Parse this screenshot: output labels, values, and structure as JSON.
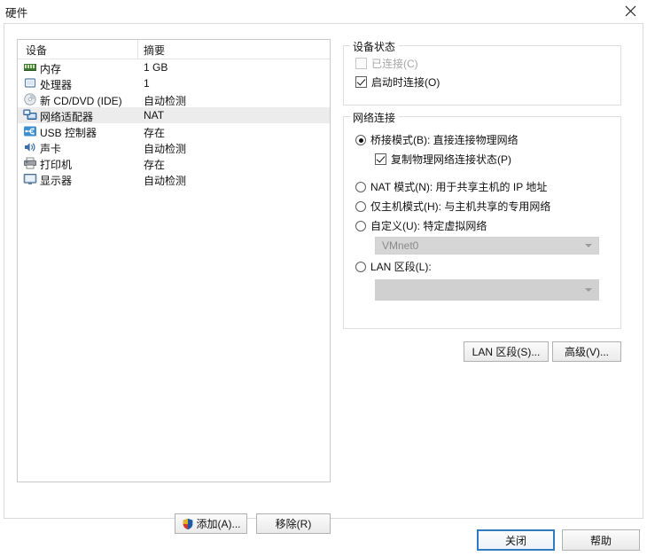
{
  "window": {
    "title": "硬件",
    "close_icon": "close-icon"
  },
  "device_list": {
    "columns": [
      "设备",
      "摘要"
    ],
    "rows": [
      {
        "icon": "memory-icon",
        "name": "内存",
        "summary": "1 GB",
        "selected": false
      },
      {
        "icon": "processor-icon",
        "name": "处理器",
        "summary": "1",
        "selected": false
      },
      {
        "icon": "cd-dvd-icon",
        "name": "新 CD/DVD (IDE)",
        "summary": "自动检测",
        "selected": false
      },
      {
        "icon": "network-adapter-icon",
        "name": "网络适配器",
        "summary": "NAT",
        "selected": true
      },
      {
        "icon": "usb-controller-icon",
        "name": "USB 控制器",
        "summary": "存在",
        "selected": false
      },
      {
        "icon": "sound-card-icon",
        "name": "声卡",
        "summary": "自动检测",
        "selected": false
      },
      {
        "icon": "printer-icon",
        "name": "打印机",
        "summary": "存在",
        "selected": false
      },
      {
        "icon": "display-icon",
        "name": "显示器",
        "summary": "自动检测",
        "selected": false
      }
    ],
    "add_button": "添加(A)...",
    "add_button_icon": "uac-shield-icon",
    "remove_button": "移除(R)"
  },
  "device_status": {
    "legend": "设备状态",
    "options": [
      {
        "label": "已连接(C)",
        "checked": false,
        "disabled": true
      },
      {
        "label": "启动时连接(O)",
        "checked": true,
        "disabled": false
      }
    ]
  },
  "network_connection": {
    "legend": "网络连接",
    "options": [
      {
        "label": "桥接模式(B): 直接连接物理网络",
        "selected": true
      },
      {
        "label": "NAT 模式(N): 用于共享主机的 IP 地址",
        "selected": false
      },
      {
        "label": "仅主机模式(H): 与主机共享的专用网络",
        "selected": false
      },
      {
        "label": "自定义(U): 特定虚拟网络",
        "selected": false
      },
      {
        "label": "LAN 区段(L):",
        "selected": false
      }
    ],
    "bridged_suboption": {
      "label": "复制物理网络连接状态(P)",
      "checked": true
    },
    "custom_network_value": "VMnet0",
    "lan_segment_value": "",
    "lan_segment_button": "LAN 区段(S)...",
    "advanced_button": "高级(V)..."
  },
  "footer": {
    "close_button": "关闭",
    "help_button": "帮助"
  },
  "colors": {
    "focus_border": "#2f7cc4",
    "selection_row": "#ececec",
    "groupbox_border": "#dedede",
    "disabled_text": "#a6a6a6"
  }
}
